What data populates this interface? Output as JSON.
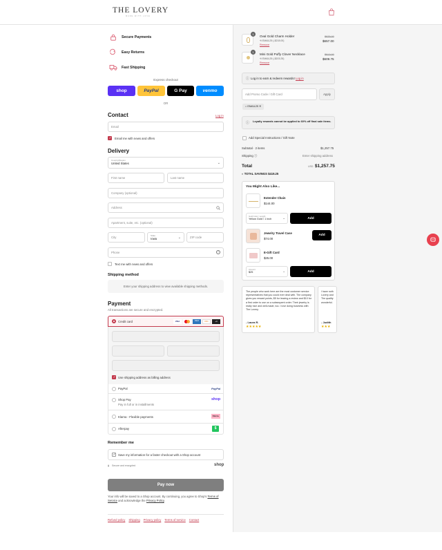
{
  "brand": {
    "name": "THE LOVERY",
    "sub": "MADE WITH LOVE"
  },
  "trust": [
    {
      "label": "Secure Payments",
      "icon": "lock-icon"
    },
    {
      "label": "Easy Returns",
      "icon": "returns-icon"
    },
    {
      "label": "Fast Shipping",
      "icon": "truck-icon"
    }
  ],
  "express": {
    "title": "Express checkout",
    "shop": "shop",
    "paypal": "PayPal",
    "gpay": "G Pay",
    "venmo": "venmo",
    "or": "OR"
  },
  "contact": {
    "title": "Contact",
    "login": "Log in",
    "email_placeholder": "Email",
    "email_news": "Email me with news and offers"
  },
  "delivery": {
    "title": "Delivery",
    "country_label": "Country/Region",
    "country_value": "United States",
    "first_name": "First name",
    "last_name": "Last name",
    "company": "Company (optional)",
    "address": "Address",
    "apartment": "Apartment, suite, etc. (optional)",
    "city": "City",
    "state_label": "State",
    "state_value": "Iowa",
    "zip": "ZIP code",
    "phone": "Phone",
    "text_news": "Text me with news and offers"
  },
  "shipping": {
    "title": "Shipping method",
    "note": "Enter your shipping address to view available shipping methods."
  },
  "payment": {
    "title": "Payment",
    "subtitle": "All transactions are secure and encrypted.",
    "credit_card": "Credit card",
    "card_brands": [
      "VISA",
      "MC",
      "AMEX",
      "DISC",
      "+3"
    ],
    "billing_same": "Use shipping address as billing address",
    "paypal": "PayPal",
    "shoppay": "Shop Pay",
    "shoppay_sub": "Pay in full or in installments",
    "klarna": "Klarna - Flexible payments",
    "afterpay": "Afterpay",
    "paypal_logo": "PayPal",
    "shop_logo": "shop",
    "klarna_logo": "Klarna.",
    "afterpay_logo": "$"
  },
  "remember": {
    "title": "Remember me",
    "save_info": "Save my information for a faster checkout with a Shop account",
    "secure": "Secure and encrypted",
    "shop": "shop"
  },
  "pay_now": "Pay now",
  "legal": {
    "text": "Your info will be saved to a Shop account. By continuing, you agree to Shop's",
    "terms": "Terms of Service",
    "and": "and acknowledge the",
    "privacy": "Privacy Policy",
    "end": "."
  },
  "footer_links": [
    "Refund policy",
    "Shipping",
    "Privacy policy",
    "Terms of service",
    "Contact"
  ],
  "cart": {
    "items": [
      {
        "qty": "1",
        "name": "Oval Gold Charm Holder",
        "discount": "EMAIL25 (-$218.00)",
        "remove": "Remove",
        "old_price": "$875.00",
        "price": "$657.00"
      },
      {
        "qty": "1",
        "name": "Mini Gold Puffy Clover Necklace",
        "discount": "EMAIL25 (-$203.25)",
        "remove": "Remove",
        "old_price": "$813.00",
        "price": "$609.75"
      }
    ],
    "login_rewards": "Log in to earn & redeem rewards!",
    "login_link": "Log in",
    "promo_placeholder": "Add Promo Code / Gift Card",
    "apply": "Apply",
    "tag": "EMAIL25",
    "loyalty_note": "Loyalty rewards cannot be applied to 60% off final sale items.",
    "instructions": "Add Special Instructions / Gift Note",
    "subtotal_label": "Subtotal · 2 items",
    "subtotal_value": "$1,257.75",
    "shipping_label": "Shipping",
    "shipping_value": "Enter shipping address",
    "total_label": "Total",
    "currency": "USD",
    "total_value": "$1,257.75",
    "savings_label": "TOTAL SAVINGS",
    "savings_value": "$419.25"
  },
  "upsell": {
    "title": "You Might Also Like...",
    "items": [
      {
        "name": "Extender Chain",
        "price": "$144.00",
        "select_label": "Gold Color / Length",
        "select_value": "Yellow Gold / 1 inch",
        "add": "Add"
      },
      {
        "name": "Jewelry Travel Case",
        "price": "$74.00",
        "add": "Add"
      },
      {
        "name": "E-Gift Card",
        "price": "$25.00",
        "select_label": "Amount",
        "select_value": "$25",
        "add": "Add"
      }
    ]
  },
  "reviews": [
    {
      "text": "The people who work here are the most customer service representatives that you could ever deal with. The company gives you reward points, $5 for leaving a review and $10 for a first order to use on a subsequent order. Their jewelry is really nice and well-made, too. I love doing business with The Lovery.",
      "author": "- Laura R.",
      "stars": "★★★★★"
    },
    {
      "text": "I have noth Lovery and The quality wonderful.",
      "author": "- Judith",
      "stars": "★★★"
    }
  ],
  "colors": {
    "accent": "#c33a4d",
    "shop": "#5a31f4",
    "paypal": "#ffc439",
    "venmo": "#008cff"
  }
}
